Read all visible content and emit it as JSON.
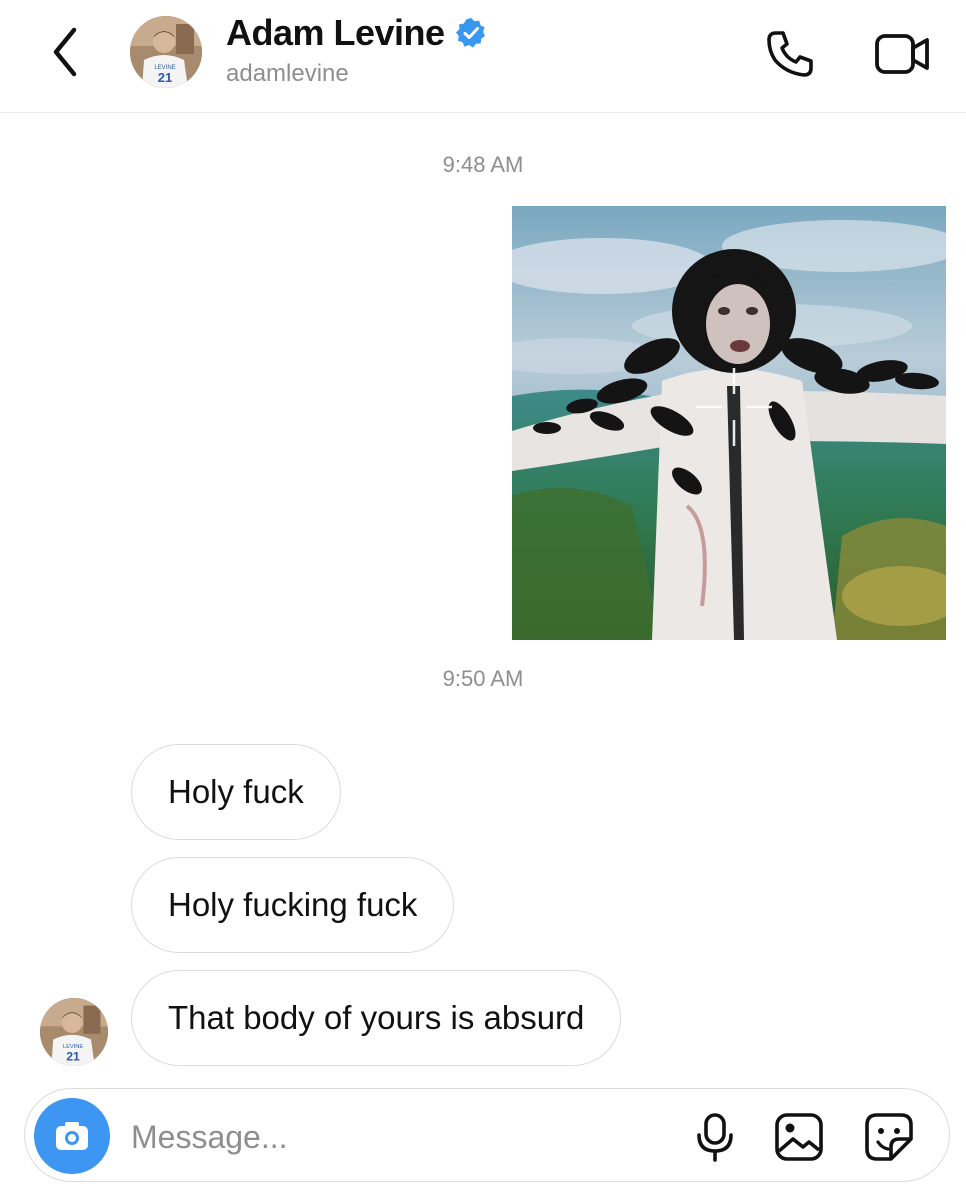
{
  "header": {
    "name": "Adam Levine",
    "handle": "adamlevine",
    "jersey_number": "21",
    "jersey_name": "LEVINE"
  },
  "conversation": {
    "timestamps": [
      "9:48 AM",
      "9:50 AM"
    ],
    "messages": [
      {
        "sender": "other",
        "text": "Holy fuck"
      },
      {
        "sender": "other",
        "text": "Holy fucking fuck"
      },
      {
        "sender": "other",
        "text": "That body of yours is absurd"
      }
    ]
  },
  "composer": {
    "placeholder": "Message..."
  },
  "icons": {
    "back": "chevron-left-icon",
    "verified": "verified-badge-icon",
    "call": "phone-icon",
    "video": "video-camera-icon",
    "camera": "camera-icon",
    "mic": "microphone-icon",
    "gallery": "image-gallery-icon",
    "sticker": "sticker-icon"
  },
  "colors": {
    "verified": "#3897f0",
    "camera_button": "#3d97f2",
    "secondary_text": "#8e8e8e",
    "bubble_border": "#dbdbdb"
  }
}
